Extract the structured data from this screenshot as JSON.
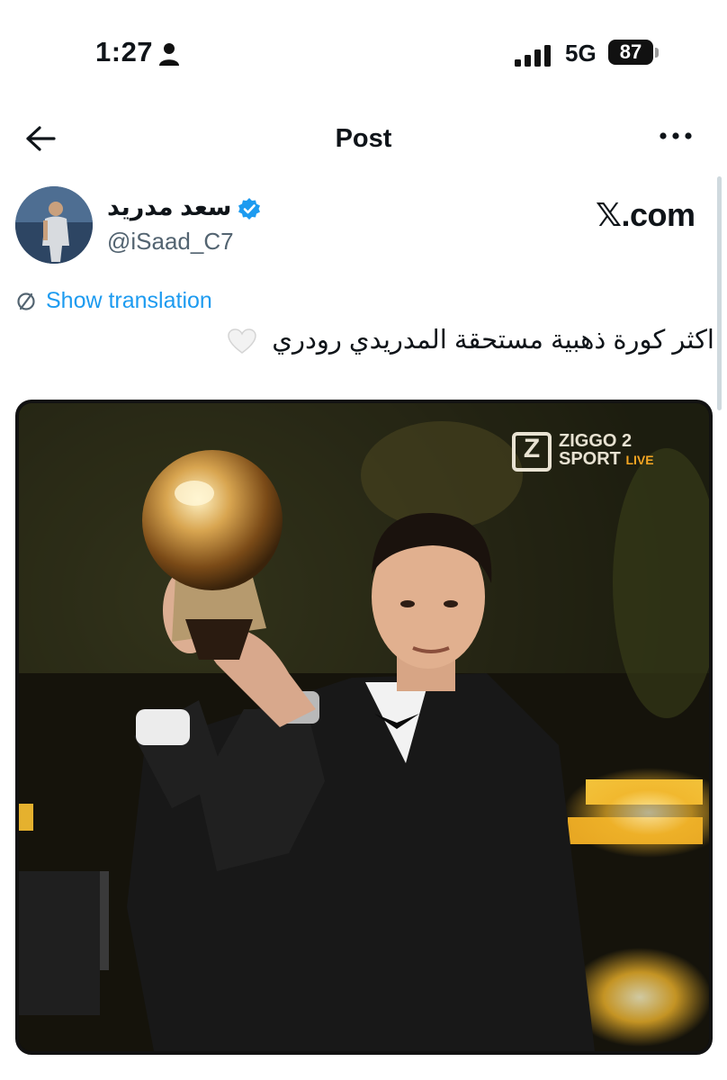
{
  "status_bar": {
    "time": "1:27",
    "network": "5G",
    "battery": "87"
  },
  "nav": {
    "title": "Post"
  },
  "author": {
    "display_name": "سعد مدريد",
    "handle": "@iSaad_C7",
    "verified": true
  },
  "source_label": "𝕏.com",
  "translate": {
    "label": "Show translation"
  },
  "tweet": {
    "text": "اكثر كورة ذهبية مستحقة المدريدي رودري",
    "emoji": "white-heart-icon"
  },
  "media": {
    "broadcaster_line1": "ZIGGO 2",
    "broadcaster_line2": "SPORT",
    "broadcaster_live": "LIVE",
    "broadcaster_logo_letter": "Z"
  },
  "colors": {
    "link": "#1d9bf0",
    "verified": "#1d9bf0",
    "text_secondary": "#536471"
  }
}
